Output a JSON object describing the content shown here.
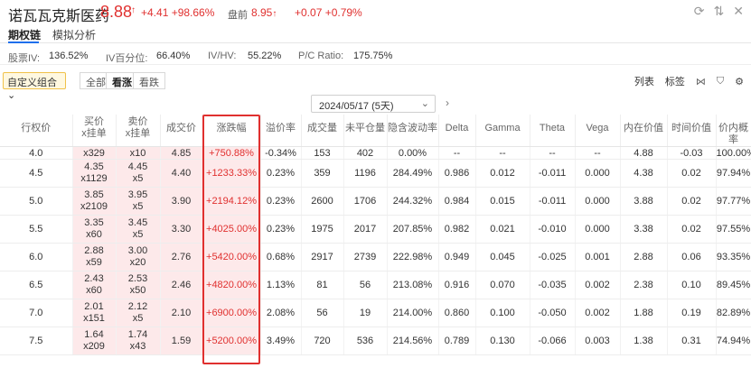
{
  "header": {
    "name": "诺瓦瓦克斯医药",
    "price": "8.88",
    "arrow": "↑",
    "change": "+4.41 +98.66%",
    "pre_label": "盘前",
    "pre_price": "8.95",
    "pre_arrow": "↑",
    "pre_change": "+0.07 +0.79%"
  },
  "tabs": [
    "期权链",
    "模拟分析"
  ],
  "stats": {
    "iv_label": "股票IV:",
    "iv_value": "136.52%",
    "ivp_label": "IV百分位:",
    "ivp_value": "66.40%",
    "ivhv_label": "IV/HV:",
    "ivhv_value": "55.22%",
    "pc_label": "P/C Ratio:",
    "pc_value": "175.75%"
  },
  "toolbar": {
    "combo": "自定义组合",
    "seg_all": "全部",
    "seg_up": "看涨",
    "seg_down": "看跌",
    "list": "列表",
    "tag": "标签"
  },
  "date_selector": "2024/05/17 (5天)",
  "columns": [
    "行权价",
    "买价\nx挂单",
    "卖价\nx挂单",
    "成交价",
    "涨跌幅",
    "溢价率",
    "成交量",
    "未平仓量",
    "隐含波动率",
    "Delta",
    "Gamma",
    "Theta",
    "Vega",
    "内在价值",
    "时间价值",
    "价内概率"
  ],
  "rows": [
    {
      "strike": "4.0",
      "bid": "",
      "bidq": "x329",
      "ask": "",
      "askq": "x10",
      "last": "4.85",
      "pct": "+750.88%",
      "prem": "-0.34%",
      "vol": "153",
      "oi": "402",
      "iv": "0.00%",
      "delta": "--",
      "gamma": "--",
      "theta": "--",
      "vega": "--",
      "intr": "4.88",
      "time": "-0.03",
      "prob": "100.00%"
    },
    {
      "strike": "4.5",
      "bid": "4.35",
      "bidq": "x1129",
      "ask": "4.45",
      "askq": "x5",
      "last": "4.40",
      "pct": "+1233.33%",
      "prem": "0.23%",
      "vol": "359",
      "oi": "1196",
      "iv": "284.49%",
      "delta": "0.986",
      "gamma": "0.012",
      "theta": "-0.011",
      "vega": "0.000",
      "intr": "4.38",
      "time": "0.02",
      "prob": "97.94%"
    },
    {
      "strike": "5.0",
      "bid": "3.85",
      "bidq": "x2109",
      "ask": "3.95",
      "askq": "x5",
      "last": "3.90",
      "pct": "+2194.12%",
      "prem": "0.23%",
      "vol": "2600",
      "oi": "1706",
      "iv": "244.32%",
      "delta": "0.984",
      "gamma": "0.015",
      "theta": "-0.011",
      "vega": "0.000",
      "intr": "3.88",
      "time": "0.02",
      "prob": "97.77%"
    },
    {
      "strike": "5.5",
      "bid": "3.35",
      "bidq": "x60",
      "ask": "3.45",
      "askq": "x5",
      "last": "3.30",
      "pct": "+4025.00%",
      "prem": "0.23%",
      "vol": "1975",
      "oi": "2017",
      "iv": "207.85%",
      "delta": "0.982",
      "gamma": "0.021",
      "theta": "-0.010",
      "vega": "0.000",
      "intr": "3.38",
      "time": "0.02",
      "prob": "97.55%"
    },
    {
      "strike": "6.0",
      "bid": "2.88",
      "bidq": "x59",
      "ask": "3.00",
      "askq": "x20",
      "last": "2.76",
      "pct": "+5420.00%",
      "prem": "0.68%",
      "vol": "2917",
      "oi": "2739",
      "iv": "222.98%",
      "delta": "0.949",
      "gamma": "0.045",
      "theta": "-0.025",
      "vega": "0.001",
      "intr": "2.88",
      "time": "0.06",
      "prob": "93.35%"
    },
    {
      "strike": "6.5",
      "bid": "2.43",
      "bidq": "x60",
      "ask": "2.53",
      "askq": "x50",
      "last": "2.46",
      "pct": "+4820.00%",
      "prem": "1.13%",
      "vol": "81",
      "oi": "56",
      "iv": "213.08%",
      "delta": "0.916",
      "gamma": "0.070",
      "theta": "-0.035",
      "vega": "0.002",
      "intr": "2.38",
      "time": "0.10",
      "prob": "89.45%"
    },
    {
      "strike": "7.0",
      "bid": "2.01",
      "bidq": "x151",
      "ask": "2.12",
      "askq": "x5",
      "last": "2.10",
      "pct": "+6900.00%",
      "prem": "2.08%",
      "vol": "56",
      "oi": "19",
      "iv": "214.00%",
      "delta": "0.860",
      "gamma": "0.100",
      "theta": "-0.050",
      "vega": "0.002",
      "intr": "1.88",
      "time": "0.19",
      "prob": "82.89%"
    },
    {
      "strike": "7.5",
      "bid": "1.64",
      "bidq": "x209",
      "ask": "1.74",
      "askq": "x43",
      "last": "1.59",
      "pct": "+5200.00%",
      "prem": "3.49%",
      "vol": "720",
      "oi": "536",
      "iv": "214.56%",
      "delta": "0.789",
      "gamma": "0.130",
      "theta": "-0.066",
      "vega": "0.003",
      "intr": "1.38",
      "time": "0.31",
      "prob": "74.94%"
    }
  ]
}
